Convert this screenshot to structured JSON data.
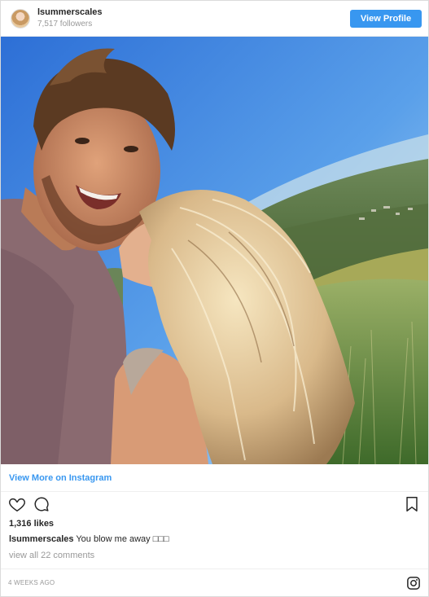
{
  "header": {
    "username": "lsummerscales",
    "followers": "7,517 followers",
    "view_profile_label": "View Profile"
  },
  "post": {
    "image_alt": "Selfie of a smiling man and a woman kissing his cheek on a sunny hillside",
    "view_more_label": "View More on Instagram",
    "likes": "1,316 likes",
    "caption_user": "lsummerscales",
    "caption_text": " You blow me away ",
    "caption_boxes": "□□□",
    "comments_link": "view all 22 comments",
    "timestamp": "4 WEEKS AGO"
  },
  "icons": {
    "like": "heart-icon",
    "comment": "comment-icon",
    "save": "bookmark-icon",
    "brand": "instagram-icon"
  },
  "colors": {
    "accent": "#3897f0",
    "muted": "#999999",
    "text": "#262626"
  }
}
